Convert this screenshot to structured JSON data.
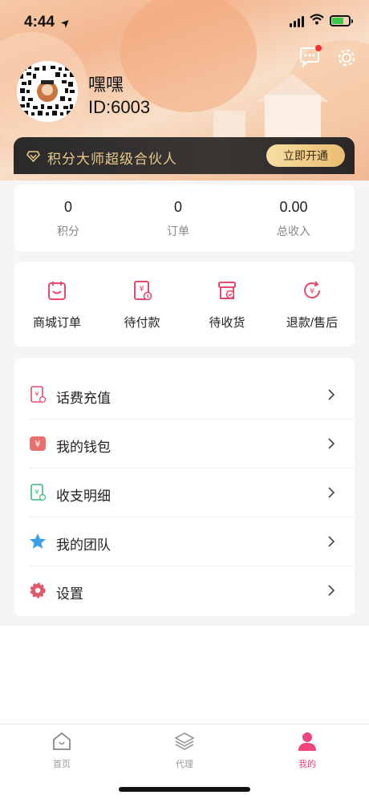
{
  "status_bar": {
    "time": "4:44",
    "location_arrow": "➤"
  },
  "profile": {
    "name": "嘿嘿",
    "user_id": "ID:6003"
  },
  "vip_banner": {
    "text": "积分大师超级合伙人",
    "button": "立即开通"
  },
  "stats": [
    {
      "value": "0",
      "label": "积分"
    },
    {
      "value": "0",
      "label": "订单"
    },
    {
      "value": "0.00",
      "label": "总收入"
    }
  ],
  "orders": [
    {
      "label": "商城订单",
      "icon": "mall-order-icon"
    },
    {
      "label": "待付款",
      "icon": "pending-payment-icon"
    },
    {
      "label": "待收货",
      "icon": "pending-receipt-icon"
    },
    {
      "label": "退款/售后",
      "icon": "refund-icon"
    }
  ],
  "menu": [
    {
      "label": "话费充值",
      "icon": "phone-recharge-icon"
    },
    {
      "label": "我的钱包",
      "icon": "wallet-icon"
    },
    {
      "label": "收支明细",
      "icon": "transactions-icon"
    },
    {
      "label": "我的团队",
      "icon": "team-star-icon"
    },
    {
      "label": "设置",
      "icon": "settings-gear-icon"
    }
  ],
  "tabs": [
    {
      "label": "首页",
      "icon": "home-icon",
      "active": false
    },
    {
      "label": "代理",
      "icon": "layers-icon",
      "active": false
    },
    {
      "label": "我的",
      "icon": "profile-icon",
      "active": true
    }
  ],
  "colors": {
    "accent": "#f0457a",
    "gold": "#e8c98b",
    "icon_red": "#e84a6e",
    "icon_green": "#3dbb7a",
    "star_blue": "#3a9ee8"
  }
}
